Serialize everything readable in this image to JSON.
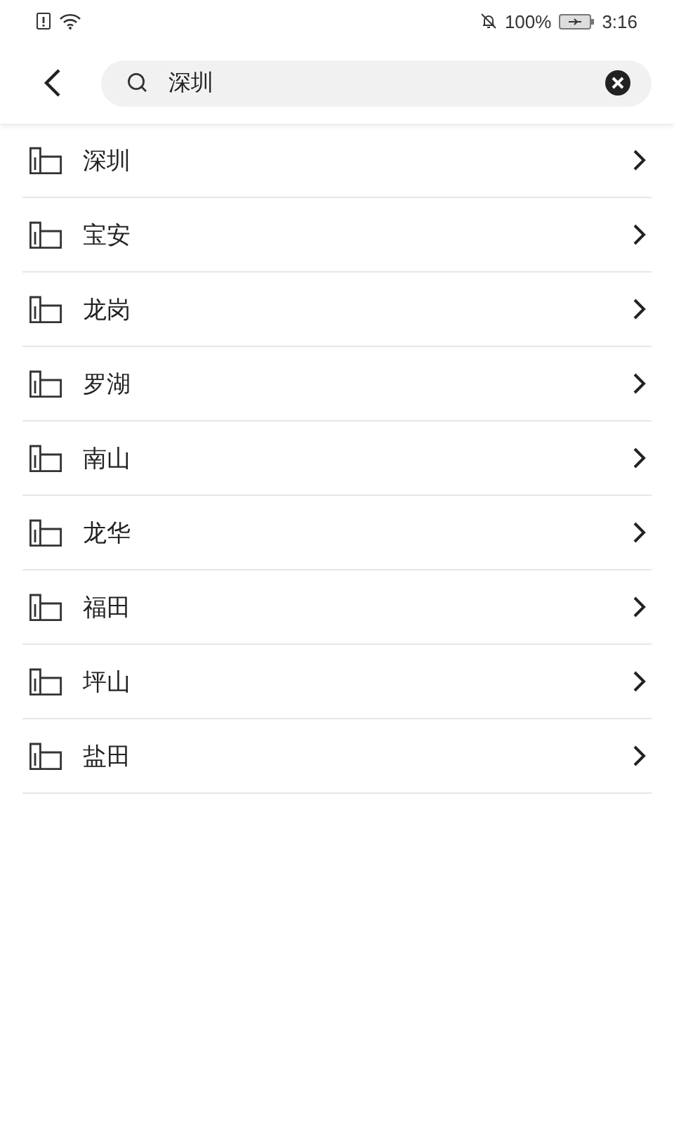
{
  "status_bar": {
    "battery": "100%",
    "time": "3:16"
  },
  "search": {
    "value": "深圳"
  },
  "results": [
    {
      "name": "深圳"
    },
    {
      "name": "宝安"
    },
    {
      "name": "龙岗"
    },
    {
      "name": "罗湖"
    },
    {
      "name": "南山"
    },
    {
      "name": "龙华"
    },
    {
      "name": "福田"
    },
    {
      "name": "坪山"
    },
    {
      "name": "盐田"
    }
  ]
}
